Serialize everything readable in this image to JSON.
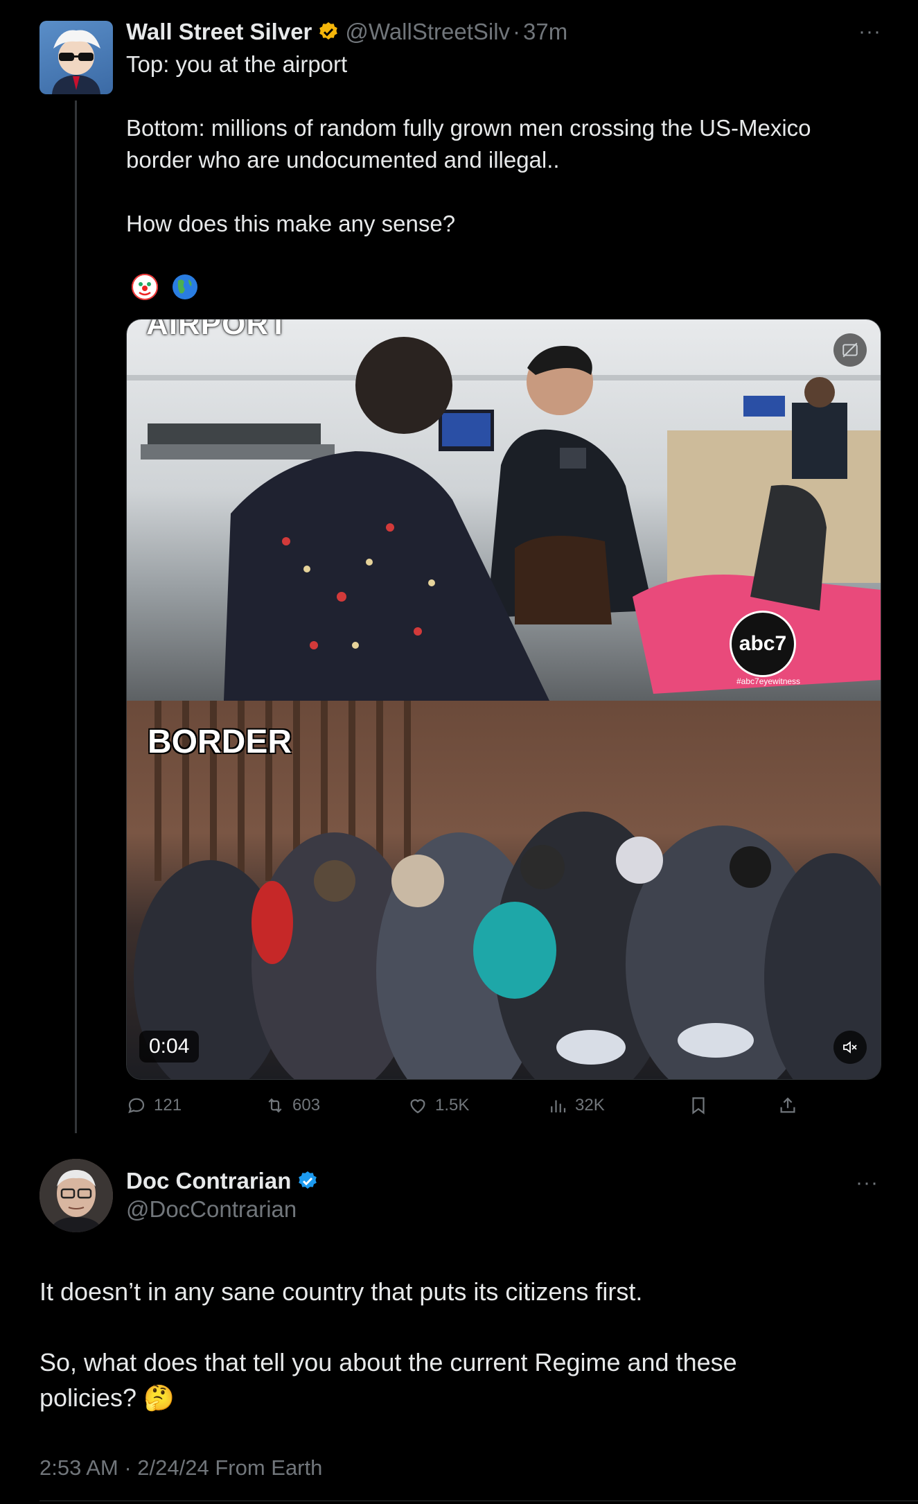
{
  "tweet": {
    "author_name": "Wall Street Silver",
    "author_handle": "@WallStreetSilv",
    "separator": "·",
    "time_ago": "37m",
    "more_label": "···",
    "text_lines": [
      "Top: you at the airport",
      "",
      "Bottom: millions of random fully grown men crossing the US-Mexico",
      "border who are undocumented and illegal..",
      "",
      "How does this make any sense?"
    ],
    "emojis": [
      "clown-face-icon",
      "globe-americas-icon"
    ],
    "media": {
      "top_caption": "AIRPORT",
      "bottom_caption": "BORDER",
      "broadcaster_logo": "abc7",
      "broadcaster_hashtag": "#abc7eyewitness",
      "duration": "0:04"
    },
    "actions": {
      "replies": "121",
      "reposts": "603",
      "likes": "1.5K",
      "views": "32K"
    },
    "colors": {
      "verified_gold": "#f5b60a",
      "muted": "#71767b",
      "text": "#e7e9ea"
    }
  },
  "reply": {
    "author_name": "Doc Contrarian",
    "author_handle": "@DocContrarian",
    "more_label": "···",
    "text_lines": [
      "It doesn’t in any sane country that puts its citizens first.",
      "",
      "So, what does that tell you about the current Regime and these",
      "policies? 🤔"
    ],
    "timestamp": "2:53 AM · 2/24/24 From Earth",
    "colors": {
      "verified_blue": "#1d9bf0"
    }
  }
}
